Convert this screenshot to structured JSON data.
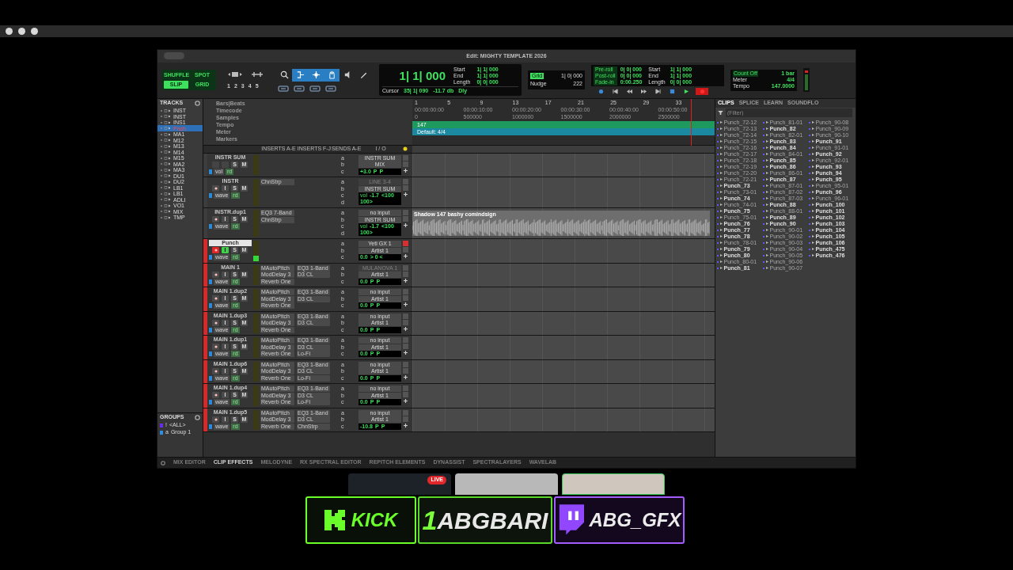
{
  "window": {
    "title": "Edit: MIGHTY TEMPLATE 2026"
  },
  "toolbar": {
    "edit_modes": [
      {
        "label": "SHUFFLE",
        "selected": false
      },
      {
        "label": "SPOT",
        "selected": false
      },
      {
        "label": "SLIP",
        "selected": true
      },
      {
        "label": "GRID",
        "selected": false
      }
    ],
    "zoom_presets": [
      "1",
      "2",
      "3",
      "4",
      "5"
    ],
    "tools": [
      {
        "kind": "zoom",
        "selected": false
      },
      {
        "kind": "trim",
        "selected": true
      },
      {
        "kind": "select",
        "selected": true
      },
      {
        "kind": "grab",
        "selected": true
      },
      {
        "kind": "scrub",
        "selected": false
      },
      {
        "kind": "pencil",
        "selected": false
      }
    ],
    "main_counter": "1| 1| 000",
    "selection": [
      {
        "label": "Start",
        "value": "1| 1| 000"
      },
      {
        "label": "End",
        "value": "1| 1| 000"
      },
      {
        "label": "Length",
        "value": "0| 0| 000"
      }
    ],
    "cursor": {
      "label": "Cursor",
      "value": "35| 1| 090",
      "db": "-11.7 db",
      "dly": "Dly"
    },
    "grid": {
      "label": "Grid",
      "value": "1| 0| 000"
    },
    "nudge": {
      "label": "Nudge",
      "value": "222"
    },
    "transport_fields": [
      {
        "label": "Pre-roll",
        "value": "0| 0| 000"
      },
      {
        "label": "Post-roll",
        "value": "0| 0| 000"
      },
      {
        "label": "Fade-in",
        "value": "0:00.250"
      }
    ],
    "transport_selection": [
      {
        "label": "Start",
        "value": "1| 1| 000"
      },
      {
        "label": "End",
        "value": "1| 1| 000"
      },
      {
        "label": "Length",
        "value": "0| 0| 000"
      }
    ],
    "transport": [
      {
        "kind": "online",
        "active": false
      },
      {
        "kind": "return",
        "active": false
      },
      {
        "kind": "rewind",
        "active": false
      },
      {
        "kind": "forward",
        "active": false
      },
      {
        "kind": "end",
        "active": false
      },
      {
        "kind": "stop",
        "active": false
      },
      {
        "kind": "play",
        "active": false
      },
      {
        "kind": "record",
        "active": true
      }
    ],
    "midi": [
      {
        "label": "Count Off",
        "value": "1 bar"
      },
      {
        "label": "Meter",
        "value": "4/4"
      },
      {
        "label": "Tempo",
        "value": "147.0000"
      }
    ]
  },
  "tracks_panel": {
    "title": "TRACKS",
    "items": [
      {
        "name": "INST",
        "selected": false
      },
      {
        "name": "INST",
        "selected": false
      },
      {
        "name": "INS1",
        "selected": false
      },
      {
        "name": "Pnch",
        "selected": true
      },
      {
        "name": "MA1",
        "selected": false
      },
      {
        "name": "M12",
        "selected": false
      },
      {
        "name": "M13",
        "selected": false
      },
      {
        "name": "M14",
        "selected": false
      },
      {
        "name": "M15",
        "selected": false
      },
      {
        "name": "MA2",
        "selected": false
      },
      {
        "name": "MA3",
        "selected": false
      },
      {
        "name": "DU1",
        "selected": false
      },
      {
        "name": "DU2",
        "selected": false
      },
      {
        "name": "LB1",
        "selected": false
      },
      {
        "name": "LB1",
        "selected": false
      },
      {
        "name": "ADLI",
        "selected": false
      },
      {
        "name": "VO1",
        "selected": false
      },
      {
        "name": "MIX",
        "selected": false
      },
      {
        "name": "TMP",
        "selected": false
      }
    ]
  },
  "groups_panel": {
    "title": "GROUPS",
    "items": [
      {
        "id": "!",
        "name": "<ALL>",
        "color": "#6a2cf0"
      },
      {
        "id": "a",
        "name": "Group 1",
        "color": "#2f8fe0"
      }
    ]
  },
  "ruler": {
    "rows": [
      "Bars|Beats",
      "Timecode",
      "Samples",
      "Tempo",
      "Meter",
      "Markers"
    ],
    "bars": [
      "1",
      "5",
      "9",
      "13",
      "17",
      "21",
      "25",
      "29",
      "33"
    ],
    "timecode": [
      "00:00:00:00",
      "00:00:10:00",
      "00:00:20:00",
      "00:00:30:00",
      "00:00:40:00",
      "00:00:50:00"
    ],
    "samples": [
      "0",
      "500000",
      "1000000",
      "1500000",
      "2000000",
      "2500000"
    ],
    "tempo": "147",
    "meter": "Default: 4/4"
  },
  "track_columns": [
    "INSERTS A-E",
    "INSERTS F-J",
    "SENDS A-E",
    "I / O"
  ],
  "tracks": [
    {
      "name": "INSTR SUM",
      "color": "#3c3c3c",
      "selected": false,
      "controls": [
        {
          "label": "S",
          "on": false
        },
        {
          "label": "M",
          "on": false
        }
      ],
      "view": "vol",
      "automation": "rd",
      "level": 0,
      "sends": [
        "a",
        "b",
        "c"
      ],
      "input": "INSTR SUM",
      "input_active": true,
      "output": "MIX",
      "volume": "+3.0",
      "pan": [
        "P",
        "P"
      ]
    },
    {
      "name": "INSTR",
      "color": "#3c3c3c",
      "selected": false,
      "record_armed": false,
      "controls": [
        {
          "label": "I",
          "on": false
        },
        {
          "label": "S",
          "on": false
        },
        {
          "label": "M",
          "on": false
        }
      ],
      "view": "wave",
      "automation": "rd",
      "level": 0,
      "inserts_a": [
        "ChnStrp"
      ],
      "sends": [
        "a",
        "b",
        "c",
        "d"
      ],
      "input": "LINE 3-4",
      "input_active": false,
      "output": "INSTR SUM",
      "volume_label": "vol",
      "volume": "-1.7",
      "pan": [
        "<100",
        "100>"
      ]
    },
    {
      "name": "INSTR.dup1",
      "color": "#3c3c3c",
      "selected": false,
      "record_armed": false,
      "controls": [
        {
          "label": "I",
          "on": false
        },
        {
          "label": "S",
          "on": false
        },
        {
          "label": "M",
          "on": false
        }
      ],
      "view": "wave",
      "automation": "rd",
      "level": 0,
      "inserts_a": [
        "EQ3 7-Band",
        "ChnStrp"
      ],
      "sends": [
        "a",
        "b",
        "c",
        "d"
      ],
      "input": "no input",
      "input_active": true,
      "output": "INSTR SUM",
      "volume_label": "vol",
      "volume": "-1.7",
      "pan": [
        "<100",
        "100>"
      ],
      "clip": {
        "name": "Shadow 147 bashy comindsign"
      }
    },
    {
      "name": "Punch",
      "color": "#d42a2a",
      "selected": true,
      "record_armed": true,
      "controls": [
        {
          "label": "I",
          "on": true
        },
        {
          "label": "S",
          "on": false
        },
        {
          "label": "M",
          "on": false
        }
      ],
      "view": "wave",
      "automation": "rd",
      "level": 0.25,
      "sends": [
        "a",
        "b",
        "c"
      ],
      "input": "Yeti GX 1",
      "input_active": true,
      "output": "Artist 1",
      "volume": "0.0",
      "pan": [
        "> 0 <"
      ]
    },
    {
      "name": "MAIN 1",
      "color": "#d42a2a",
      "selected": false,
      "record_armed": false,
      "controls": [
        {
          "label": "I",
          "on": false
        },
        {
          "label": "S",
          "on": false
        },
        {
          "label": "M",
          "on": false
        }
      ],
      "view": "wave",
      "automation": "rd",
      "level": 0,
      "inserts_a": [
        "MAutoPitch",
        "ModDelay 3",
        "Reverb One"
      ],
      "inserts_f": [
        "EQ3 1-Band",
        "D3 CL"
      ],
      "sends": [
        "a",
        "b",
        "c"
      ],
      "input": "MULANOVA 1",
      "input_active": false,
      "output": "Artist 1",
      "volume": "0.0",
      "pan": [
        "P",
        "P"
      ]
    },
    {
      "name": "MAIN 1.dup2",
      "color": "#d42a2a",
      "selected": false,
      "record_armed": false,
      "controls": [
        {
          "label": "I",
          "on": false
        },
        {
          "label": "S",
          "on": false
        },
        {
          "label": "M",
          "on": false
        }
      ],
      "view": "wave",
      "automation": "rd",
      "level": 0,
      "inserts_a": [
        "MAutoPitch",
        "ModDelay 3",
        "Reverb One"
      ],
      "inserts_f": [
        "EQ3 1-Band",
        "D3 CL"
      ],
      "sends": [
        "a",
        "b",
        "c"
      ],
      "input": "no input",
      "input_active": true,
      "output": "Artist 1",
      "volume": "0.0",
      "pan": [
        "P",
        "P"
      ]
    },
    {
      "name": "MAIN 1.dup3",
      "color": "#d42a2a",
      "selected": false,
      "record_armed": false,
      "controls": [
        {
          "label": "I",
          "on": false
        },
        {
          "label": "S",
          "on": false
        },
        {
          "label": "M",
          "on": false
        }
      ],
      "view": "wave",
      "automation": "rd",
      "level": 0,
      "inserts_a": [
        "MAutoPitch",
        "ModDelay 3",
        "Reverb One"
      ],
      "inserts_f": [
        "EQ3 1-Band",
        "D3 CL"
      ],
      "sends": [
        "a",
        "b",
        "c"
      ],
      "input": "no input",
      "input_active": true,
      "output": "Artist 1",
      "volume": "0.0",
      "pan": [
        "P",
        "P"
      ]
    },
    {
      "name": "MAIN 1.dup1",
      "color": "#d42a2a",
      "selected": false,
      "record_armed": false,
      "controls": [
        {
          "label": "I",
          "on": false
        },
        {
          "label": "S",
          "on": false
        },
        {
          "label": "M",
          "on": false
        }
      ],
      "view": "wave",
      "automation": "rd",
      "level": 0,
      "inserts_a": [
        "MAutoPitch",
        "ModDelay 3",
        "Reverb One"
      ],
      "inserts_f": [
        "EQ3 1-Band",
        "D3 CL",
        "Lo-Fi"
      ],
      "sends": [
        "a",
        "b",
        "c"
      ],
      "input": "no input",
      "input_active": true,
      "output": "Artist 1",
      "volume": "0.0",
      "pan": [
        "P",
        "P"
      ]
    },
    {
      "name": "MAIN 1.dup6",
      "color": "#d42a2a",
      "selected": false,
      "record_armed": false,
      "controls": [
        {
          "label": "I",
          "on": false
        },
        {
          "label": "S",
          "on": false
        },
        {
          "label": "M",
          "on": false
        }
      ],
      "view": "wave",
      "automation": "rd",
      "level": 0,
      "inserts_a": [
        "MAutoPitch",
        "ModDelay 3",
        "Reverb One"
      ],
      "inserts_f": [
        "EQ3 1-Band",
        "D3 CL",
        "Lo-Fi"
      ],
      "sends": [
        "a",
        "b",
        "c"
      ],
      "input": "no input",
      "input_active": true,
      "output": "Artist 1",
      "volume": "0.0",
      "pan": [
        "P",
        "P"
      ]
    },
    {
      "name": "MAIN 1.dup4",
      "color": "#d42a2a",
      "selected": false,
      "record_armed": false,
      "controls": [
        {
          "label": "I",
          "on": false
        },
        {
          "label": "S",
          "on": false
        },
        {
          "label": "M",
          "on": false
        }
      ],
      "view": "wave",
      "automation": "rd",
      "level": 0,
      "inserts_a": [
        "MAutoPitch",
        "ModDelay 3",
        "Reverb One"
      ],
      "inserts_f": [
        "EQ3 1-Band",
        "D3 CL",
        "Lo-Fi"
      ],
      "sends": [
        "a",
        "b",
        "c"
      ],
      "input": "no input",
      "input_active": true,
      "output": "Artist 1",
      "volume": "0.0",
      "pan": [
        "P",
        "P"
      ]
    },
    {
      "name": "MAIN 1.dup5",
      "color": "#d42a2a",
      "selected": false,
      "record_armed": false,
      "controls": [
        {
          "label": "I",
          "on": false
        },
        {
          "label": "S",
          "on": false
        },
        {
          "label": "M",
          "on": false
        }
      ],
      "view": "wave",
      "automation": "rd",
      "level": 0,
      "inserts_a": [
        "MAutoPitch",
        "ModDelay 3",
        "Reverb One"
      ],
      "inserts_f": [
        "EQ3 1-Band",
        "D3 CL",
        "ChnStrp"
      ],
      "sends": [
        "a",
        "b",
        "c"
      ],
      "input": "no input",
      "input_active": true,
      "output": "Artist 1",
      "volume": "-10.8",
      "pan": [
        "P",
        "P"
      ]
    }
  ],
  "clips_panel": {
    "tabs": [
      {
        "label": "CLIPS",
        "selected": true
      },
      {
        "label": "SPLICE",
        "selected": false
      },
      {
        "label": "LEARN",
        "selected": false
      },
      {
        "label": "SOUNDFLO",
        "selected": false
      }
    ],
    "filter_placeholder": "(Filter)",
    "clips": [
      {
        "name": "Punch_72-12",
        "whole": false
      },
      {
        "name": "Punch_72-13",
        "whole": false
      },
      {
        "name": "Punch_72-14",
        "whole": false
      },
      {
        "name": "Punch_72-15",
        "whole": false
      },
      {
        "name": "Punch_72-16",
        "whole": false
      },
      {
        "name": "Punch_72-17",
        "whole": false
      },
      {
        "name": "Punch_72-18",
        "whole": false
      },
      {
        "name": "Punch_72-19",
        "whole": false
      },
      {
        "name": "Punch_72-20",
        "whole": false
      },
      {
        "name": "Punch_72-21",
        "whole": false
      },
      {
        "name": "Punch_73",
        "whole": true
      },
      {
        "name": "Punch_73-01",
        "whole": false
      },
      {
        "name": "Punch_74",
        "whole": true
      },
      {
        "name": "Punch_74-01",
        "whole": false
      },
      {
        "name": "Punch_75",
        "whole": true
      },
      {
        "name": "Punch_75-01",
        "whole": false
      },
      {
        "name": "Punch_76",
        "whole": true
      },
      {
        "name": "Punch_77",
        "whole": true
      },
      {
        "name": "Punch_78",
        "whole": true
      },
      {
        "name": "Punch_78-01",
        "whole": false
      },
      {
        "name": "Punch_79",
        "whole": true
      },
      {
        "name": "Punch_80",
        "whole": true
      },
      {
        "name": "Punch_80-01",
        "whole": false
      },
      {
        "name": "Punch_81",
        "whole": true
      },
      {
        "name": "Punch_81-01",
        "whole": false
      },
      {
        "name": "Punch_82",
        "whole": true
      },
      {
        "name": "Punch_82-01",
        "whole": false
      },
      {
        "name": "Punch_83",
        "whole": true
      },
      {
        "name": "Punch_84",
        "whole": true
      },
      {
        "name": "Punch_84-01",
        "whole": false
      },
      {
        "name": "Punch_85",
        "whole": true
      },
      {
        "name": "Punch_86",
        "whole": true
      },
      {
        "name": "Punch_86-01",
        "whole": false
      },
      {
        "name": "Punch_87",
        "whole": true
      },
      {
        "name": "Punch_87-01",
        "whole": false
      },
      {
        "name": "Punch_87-02",
        "whole": false
      },
      {
        "name": "Punch_87-03",
        "whole": false
      },
      {
        "name": "Punch_88",
        "whole": true
      },
      {
        "name": "Punch_88-01",
        "whole": false
      },
      {
        "name": "Punch_89",
        "whole": true
      },
      {
        "name": "Punch_90",
        "whole": true
      },
      {
        "name": "Punch_90-01",
        "whole": false
      },
      {
        "name": "Punch_90-02",
        "whole": false
      },
      {
        "name": "Punch_90-03",
        "whole": false
      },
      {
        "name": "Punch_90-04",
        "whole": false
      },
      {
        "name": "Punch_90-05",
        "whole": false
      },
      {
        "name": "Punch_90-06",
        "whole": false
      },
      {
        "name": "Punch_90-07",
        "whole": false
      },
      {
        "name": "Punch_90-08",
        "whole": false
      },
      {
        "name": "Punch_90-09",
        "whole": false
      },
      {
        "name": "Punch_90-10",
        "whole": false
      },
      {
        "name": "Punch_91",
        "whole": true
      },
      {
        "name": "Punch_91-01",
        "whole": false
      },
      {
        "name": "Punch_92",
        "whole": true
      },
      {
        "name": "Punch_92-01",
        "whole": false
      },
      {
        "name": "Punch_93",
        "whole": true
      },
      {
        "name": "Punch_94",
        "whole": true
      },
      {
        "name": "Punch_95",
        "whole": true
      },
      {
        "name": "Punch_95-01",
        "whole": false
      },
      {
        "name": "Punch_96",
        "whole": true
      },
      {
        "name": "Punch_96-01",
        "whole": false
      },
      {
        "name": "Punch_100",
        "whole": true
      },
      {
        "name": "Punch_101",
        "whole": true
      },
      {
        "name": "Punch_102",
        "whole": true
      },
      {
        "name": "Punch_103",
        "whole": true
      },
      {
        "name": "Punch_104",
        "whole": true
      },
      {
        "name": "Punch_105",
        "whole": true
      },
      {
        "name": "Punch_106",
        "whole": true
      },
      {
        "name": "Punch_475",
        "whole": true
      },
      {
        "name": "Punch_476",
        "whole": true
      }
    ]
  },
  "bottom_tabs": [
    {
      "label": "MIX EDITOR",
      "selected": false
    },
    {
      "label": "CLIP EFFECTS",
      "selected": true
    },
    {
      "label": "MELODYNE",
      "selected": false
    },
    {
      "label": "RX SPECTRAL EDITOR",
      "selected": false
    },
    {
      "label": "REPITCH ELEMENTS",
      "selected": false
    },
    {
      "label": "DYNASSIST",
      "selected": false
    },
    {
      "label": "SPECTRALAYERS",
      "selected": false
    },
    {
      "label": "WAVELAB",
      "selected": false
    }
  ],
  "stream_overlay": {
    "live_badge": "LIVE",
    "kick_label": "KICK",
    "channel_number": "1",
    "channel_name": "ABGBARI",
    "twitch_name": "ABG_GFX"
  }
}
